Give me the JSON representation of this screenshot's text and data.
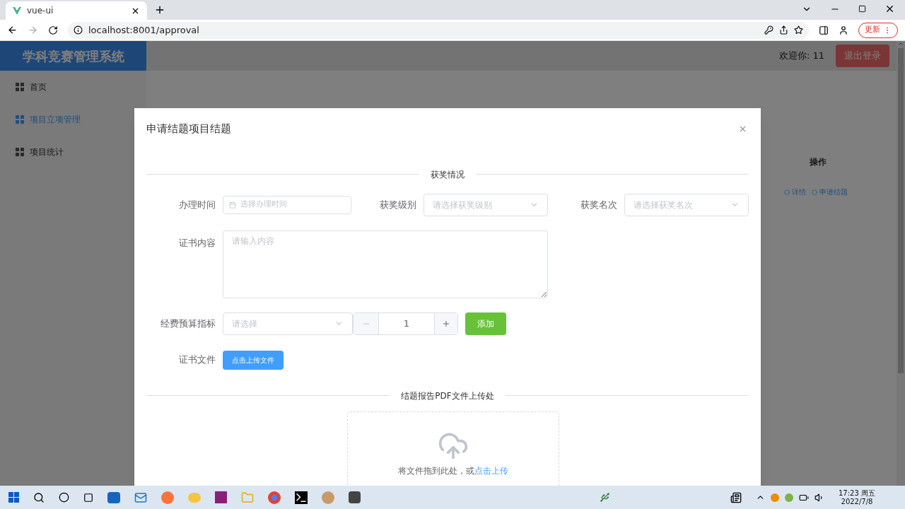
{
  "browser": {
    "tab_title": "vue-ui",
    "url": "localhost:8001/approval",
    "update_button": "更新"
  },
  "app": {
    "title": "学科竞赛管理系统",
    "welcome": "欢迎你: 11",
    "logout": "退出登录",
    "menu": [
      {
        "label": "首页",
        "selected": false
      },
      {
        "label": "项目立项管理",
        "selected": true
      },
      {
        "label": "项目统计",
        "selected": false
      }
    ],
    "table": {
      "column_header": "操作",
      "actions": [
        "详情",
        "申请结题"
      ]
    }
  },
  "dialog": {
    "title": "申请结题项目结题",
    "section_1": "获奖情况",
    "date": {
      "label": "办理时间",
      "placeholder": "选择办理时间"
    },
    "award_level": {
      "label": "获奖级别",
      "placeholder": "请选择获奖级别"
    },
    "award_rank": {
      "label": "获奖名次",
      "placeholder": "请选择获奖名次"
    },
    "certificate_content": {
      "label": "证书内容",
      "placeholder": "请输入内容"
    },
    "budget": {
      "label": "经费预算指标",
      "placeholder": "请选择",
      "quantity": "1",
      "add_button": "添加"
    },
    "certificate_file": {
      "label": "证书文件",
      "button": "点击上传文件"
    },
    "section_2": "结题报告PDF文件上传处",
    "upload": {
      "hint": "将文件拖到此处，或",
      "link": "点击上传"
    }
  },
  "taskbar": {
    "time": "17:23 周五",
    "date": "2022/7/8"
  }
}
